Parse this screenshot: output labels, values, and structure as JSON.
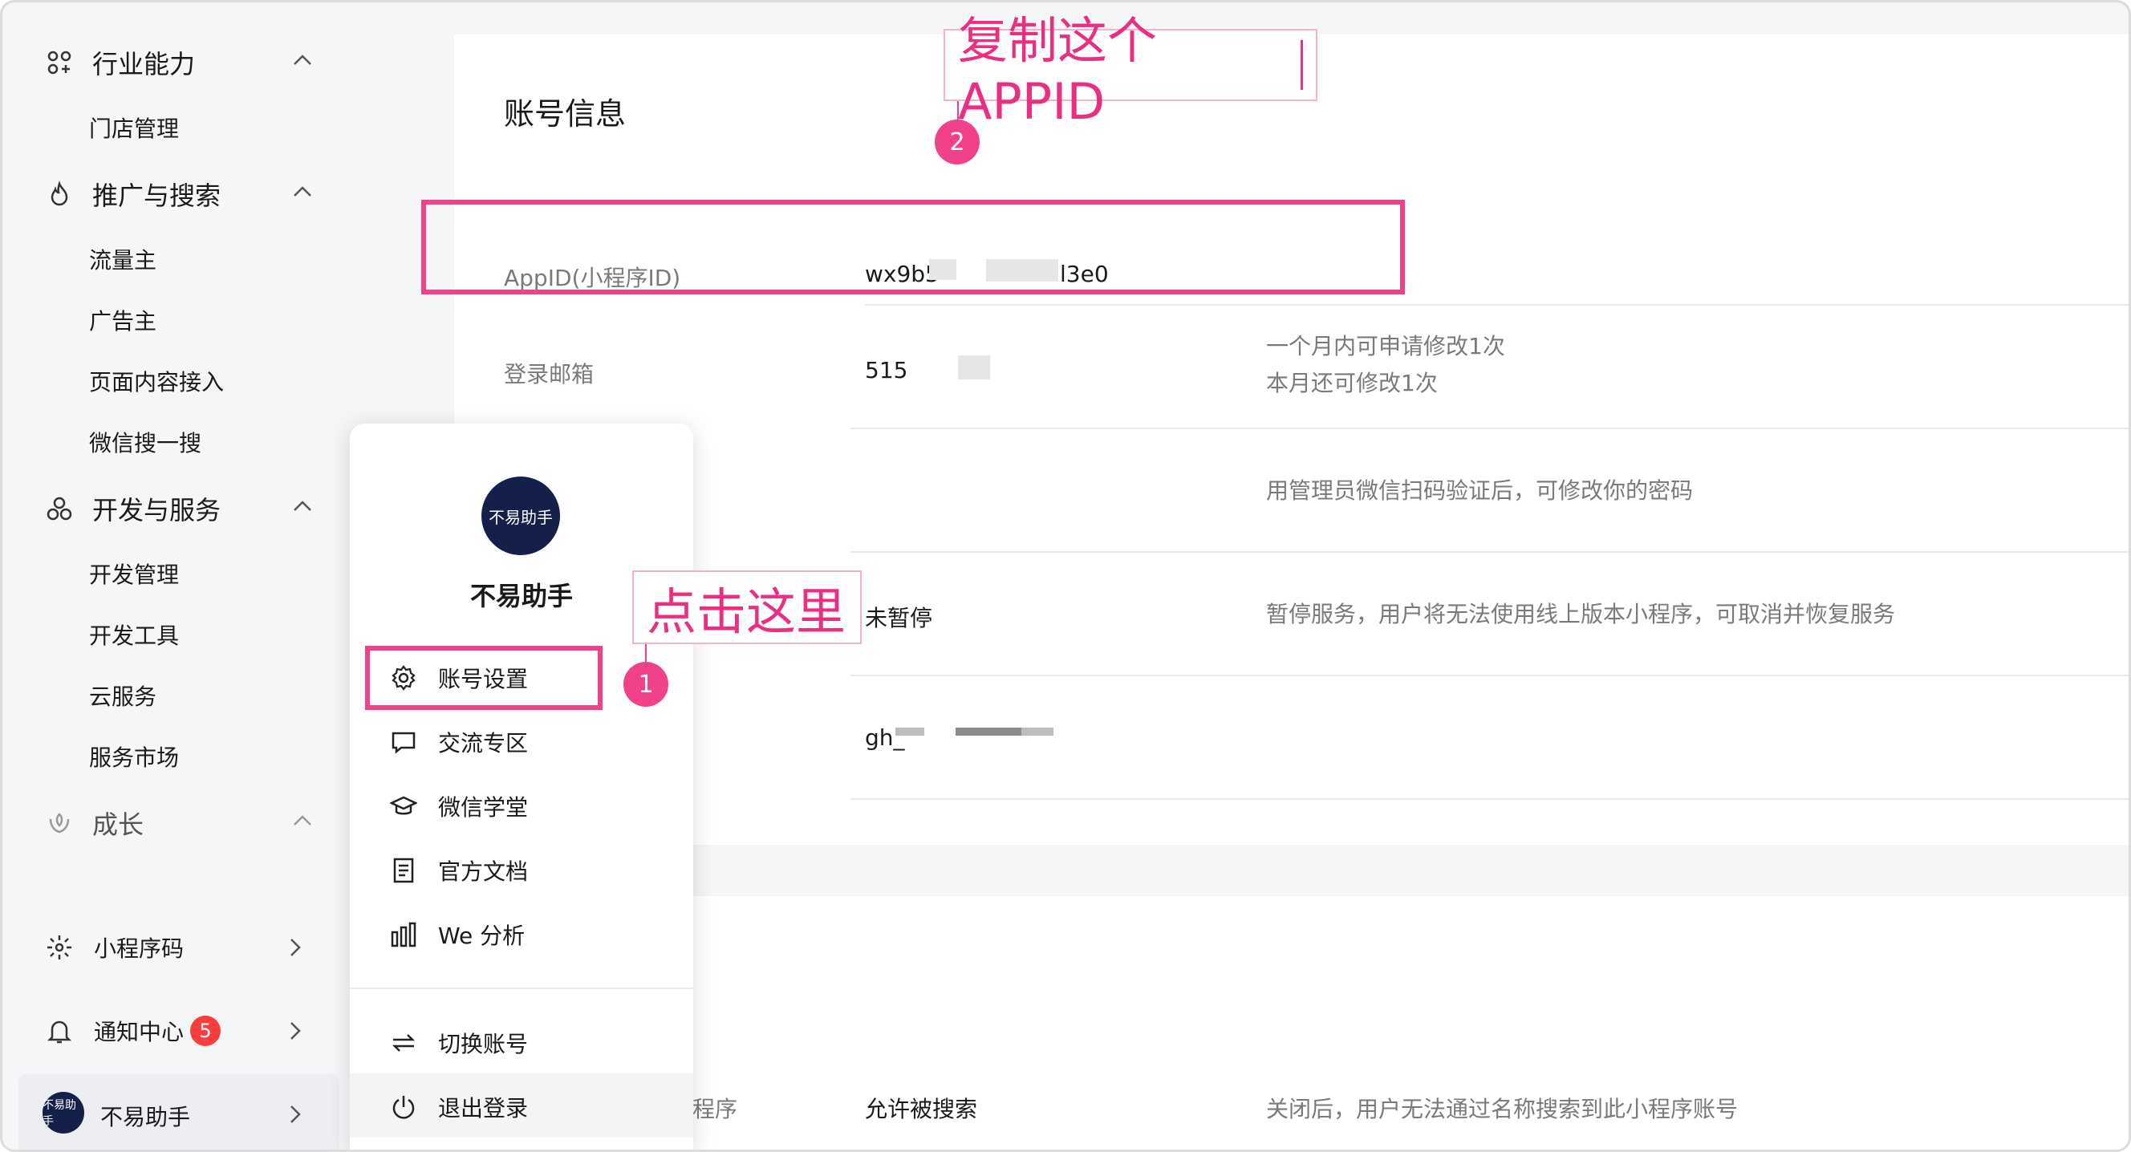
{
  "sidebar": {
    "groups": [
      {
        "label": "行业能力",
        "icon": "industry-icon",
        "children": [
          "门店管理"
        ]
      },
      {
        "label": "推广与搜索",
        "icon": "flame-icon",
        "children": [
          "流量主",
          "广告主",
          "页面内容接入",
          "微信搜一搜"
        ]
      },
      {
        "label": "开发与服务",
        "icon": "dev-services-icon",
        "children": [
          "开发管理",
          "开发工具",
          "云服务",
          "服务市场"
        ]
      },
      {
        "label": "成长",
        "icon": "growth-icon",
        "children": []
      }
    ],
    "bottom": [
      {
        "label": "小程序码",
        "icon": "miniprogram-code-icon"
      },
      {
        "label": "通知中心",
        "icon": "bell-icon",
        "badge": "5"
      }
    ],
    "user": {
      "name": "不易助手",
      "avatar_text": "不易助手"
    }
  },
  "account": {
    "title": "账号信息",
    "rows": [
      {
        "label": "AppID(小程序ID)",
        "value_prefix": "wx9b5",
        "value_suffix": "l3e0",
        "note": ""
      },
      {
        "label": "登录邮箱",
        "value": "515",
        "note_lines": [
          "一个月内可申请修改1次",
          "本月还可修改1次"
        ]
      },
      {
        "label": "",
        "value": "",
        "note": "用管理员微信扫码验证后，可修改你的密码"
      },
      {
        "label": "",
        "value": "未暂停",
        "note": "暂停服务，用户将无法使用线上版本小程序，可取消并恢复服务"
      },
      {
        "label": "",
        "value": "gh_",
        "note": ""
      }
    ],
    "lower_row": {
      "label": "程序",
      "value": "允许被搜索",
      "note": "关闭后，用户无法通过名称搜索到此小程序账号"
    }
  },
  "popover": {
    "name": "不易助手",
    "avatar_text": "不易助手",
    "items": [
      {
        "label": "账号设置",
        "icon": "gear-icon"
      },
      {
        "label": "交流专区",
        "icon": "chat-icon"
      },
      {
        "label": "微信学堂",
        "icon": "graduation-cap-icon"
      },
      {
        "label": "官方文档",
        "icon": "document-icon"
      },
      {
        "label": "We 分析",
        "icon": "analytics-icon"
      }
    ],
    "footer": [
      {
        "label": "切换账号",
        "icon": "switch-icon"
      },
      {
        "label": "退出登录",
        "icon": "power-icon"
      }
    ]
  },
  "annotations": {
    "copy_hint": "复制这个APPID",
    "click_hint": "点击这里",
    "step1": "1",
    "step2": "2",
    "color": "#f0418a"
  }
}
